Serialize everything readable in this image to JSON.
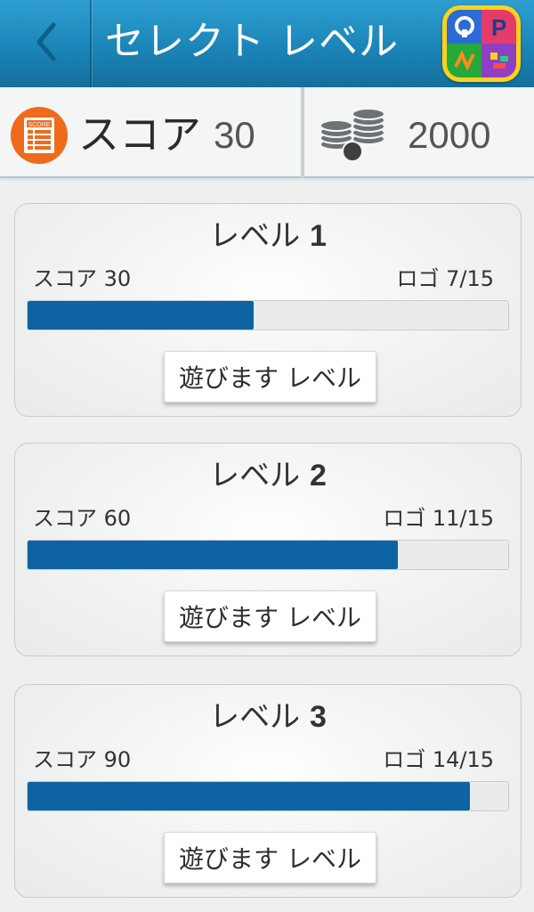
{
  "header": {
    "title": "セレクト レベル",
    "back_icon": "chevron-left-icon",
    "logo_icon": "app-logo-icon"
  },
  "stats": {
    "score_label": "スコア",
    "score_value": "30",
    "coins_value": "2000",
    "score_icon": "score-sheet-icon",
    "coins_icon": "coin-stack-icon"
  },
  "levels": [
    {
      "title": "レベル",
      "number": "1",
      "score": "スコア 30",
      "logos": "ロゴ 7/15",
      "progress": 0.47,
      "button": "遊びます レベル"
    },
    {
      "title": "レベル",
      "number": "2",
      "score": "スコア 60",
      "logos": "ロゴ 11/15",
      "progress": 0.77,
      "button": "遊びます レベル"
    },
    {
      "title": "レベル",
      "number": "3",
      "score": "スコア 90",
      "logos": "ロゴ 14/15",
      "progress": 0.92,
      "button": "遊びます レベル"
    }
  ],
  "colors": {
    "header": "#1b85b8",
    "progress": "#0d63a4",
    "score_icon": "#f06a1c",
    "logo_border": "#ffd21a"
  }
}
